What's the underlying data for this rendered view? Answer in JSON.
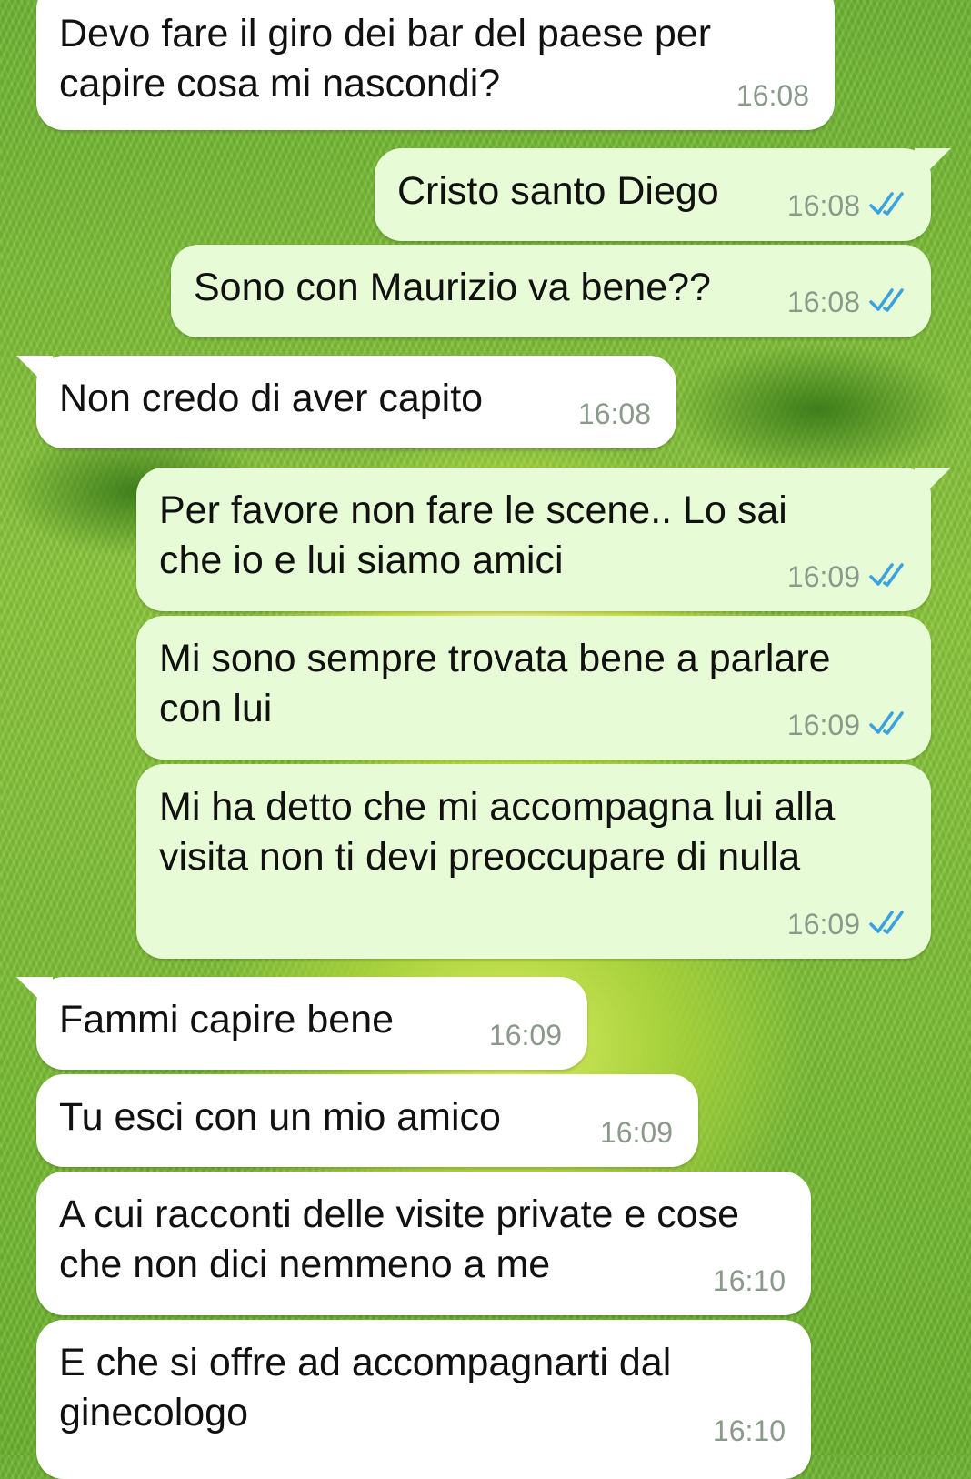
{
  "messages": [
    {
      "dir": "in",
      "lines": [
        "Devo fare il giro dei bar del paese per",
        "capire cosa mi nascondi?"
      ],
      "time": "16:08"
    },
    {
      "dir": "out",
      "lines": [
        "Cristo santo Diego"
      ],
      "time": "16:08",
      "status": "read-check-icon"
    },
    {
      "dir": "out",
      "lines": [
        "Sono con Maurizio va bene??"
      ],
      "time": "16:08",
      "status": "read-check-icon"
    },
    {
      "dir": "in",
      "lines": [
        "Non credo di aver capito"
      ],
      "time": "16:08"
    },
    {
      "dir": "out",
      "lines": [
        "Per favore non fare le scene.. Lo sai",
        "che io e lui siamo amici"
      ],
      "time": "16:09",
      "status": "read-check-icon"
    },
    {
      "dir": "out",
      "lines": [
        "Mi sono sempre trovata bene a parlare",
        "con lui"
      ],
      "time": "16:09",
      "status": "read-check-icon"
    },
    {
      "dir": "out",
      "lines": [
        "Mi ha detto che mi accompagna lui alla",
        "visita non ti devi preoccupare di nulla"
      ],
      "time": "16:09",
      "status": "read-check-icon"
    },
    {
      "dir": "in",
      "lines": [
        "Fammi capire bene"
      ],
      "time": "16:09"
    },
    {
      "dir": "in",
      "lines": [
        "Tu esci con un mio amico"
      ],
      "time": "16:09"
    },
    {
      "dir": "in",
      "lines": [
        "A cui racconti delle visite private e cose",
        "che non dici nemmeno a me"
      ],
      "time": "16:10"
    },
    {
      "dir": "in",
      "lines": [
        "E che si offre ad accompagnarti dal",
        "ginecologo"
      ],
      "time": "16:10"
    }
  ],
  "colors": {
    "incoming_bubble": "#ffffff",
    "outgoing_bubble": "#e7fcd6",
    "read_tick": "#3ba2e0",
    "timestamp": "#8a9a8a"
  }
}
